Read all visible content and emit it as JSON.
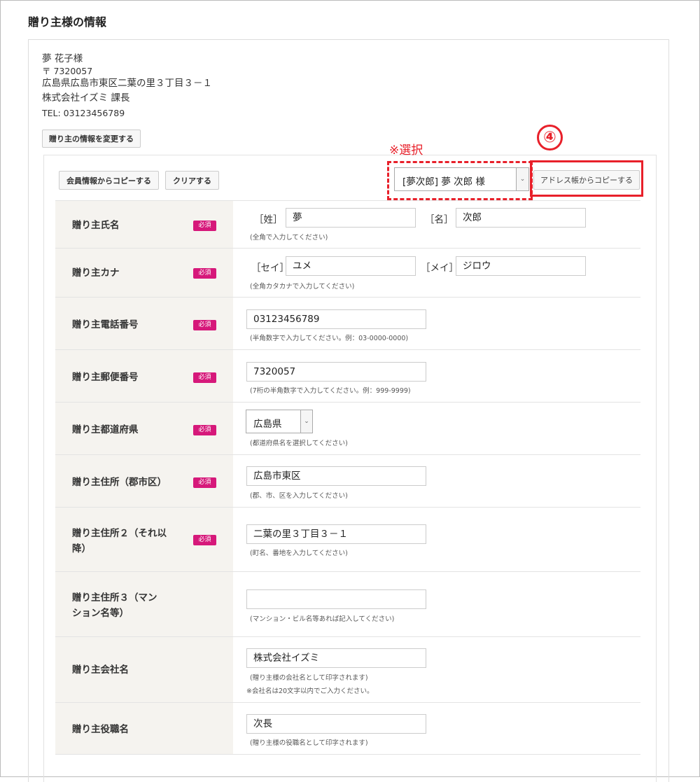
{
  "section_title": "贈り主様の情報",
  "sender": {
    "name": "夢 花子様",
    "postal": "〒 7320057",
    "address": "広島県広島市東区二葉の里３丁目３－１",
    "company": "株式会社イズミ 課長",
    "tel": "TEL: 03123456789",
    "change_button": "贈り主の情報を変更する"
  },
  "toolbar": {
    "copy_member_button": "会員情報からコピーする",
    "clear_button": "クリアする",
    "address_book_select": "[夢次郎] 夢 次郎 様",
    "address_book_button": "アドレス帳からコピーする"
  },
  "annotations": {
    "select_note": "※選択",
    "step_number": "④",
    "color": "#e8202a"
  },
  "required_badge": "必須",
  "required_badge_color": "#d6187a",
  "fields": {
    "name": {
      "label": "贈り主氏名",
      "last_bracket": "［姓］",
      "last_value": "夢",
      "first_bracket": "［名］",
      "first_value": "次郎",
      "hint": "(全角で入力してください)"
    },
    "kana": {
      "label": "贈り主カナ",
      "last_bracket": "［セイ］",
      "last_value": "ユメ",
      "first_bracket": "［メイ］",
      "first_value": "ジロウ",
      "hint": "(全角カタカナで入力してください)"
    },
    "phone": {
      "label": "贈り主電話番号",
      "value": "03123456789",
      "hint": "(半角数字で入力してください。例：03-0000-0000)"
    },
    "postal": {
      "label": "贈り主郵便番号",
      "value": "7320057",
      "hint": "(7桁の半角数字で入力してください。例：999-9999)"
    },
    "prefecture": {
      "label": "贈り主都道府県",
      "value": "広島県",
      "hint": "(都道府県名を選択してください)"
    },
    "city": {
      "label": "贈り主住所（郡市区）",
      "value": "広島市東区",
      "hint": "(郡、市、区を入力してください)"
    },
    "address2": {
      "label_line1": "贈り主住所２（それ以",
      "label_line2": "降）",
      "value": "二葉の里３丁目３－１",
      "hint": "(町名、番地を入力してください)"
    },
    "address3": {
      "label_line1": "贈り主住所３（マン",
      "label_line2": "ション名等）",
      "value": "",
      "hint": "(マンション・ビル名等あれば記入してください)"
    },
    "company": {
      "label": "贈り主会社名",
      "value": "株式会社イズミ",
      "hint": "(贈り主様の会社名として印字されます)",
      "note": "※会社名は20文字以内でご入力ください。"
    },
    "position": {
      "label": "贈り主役職名",
      "value": "次長",
      "hint": "(贈り主様の役職名として印字されます)"
    }
  }
}
